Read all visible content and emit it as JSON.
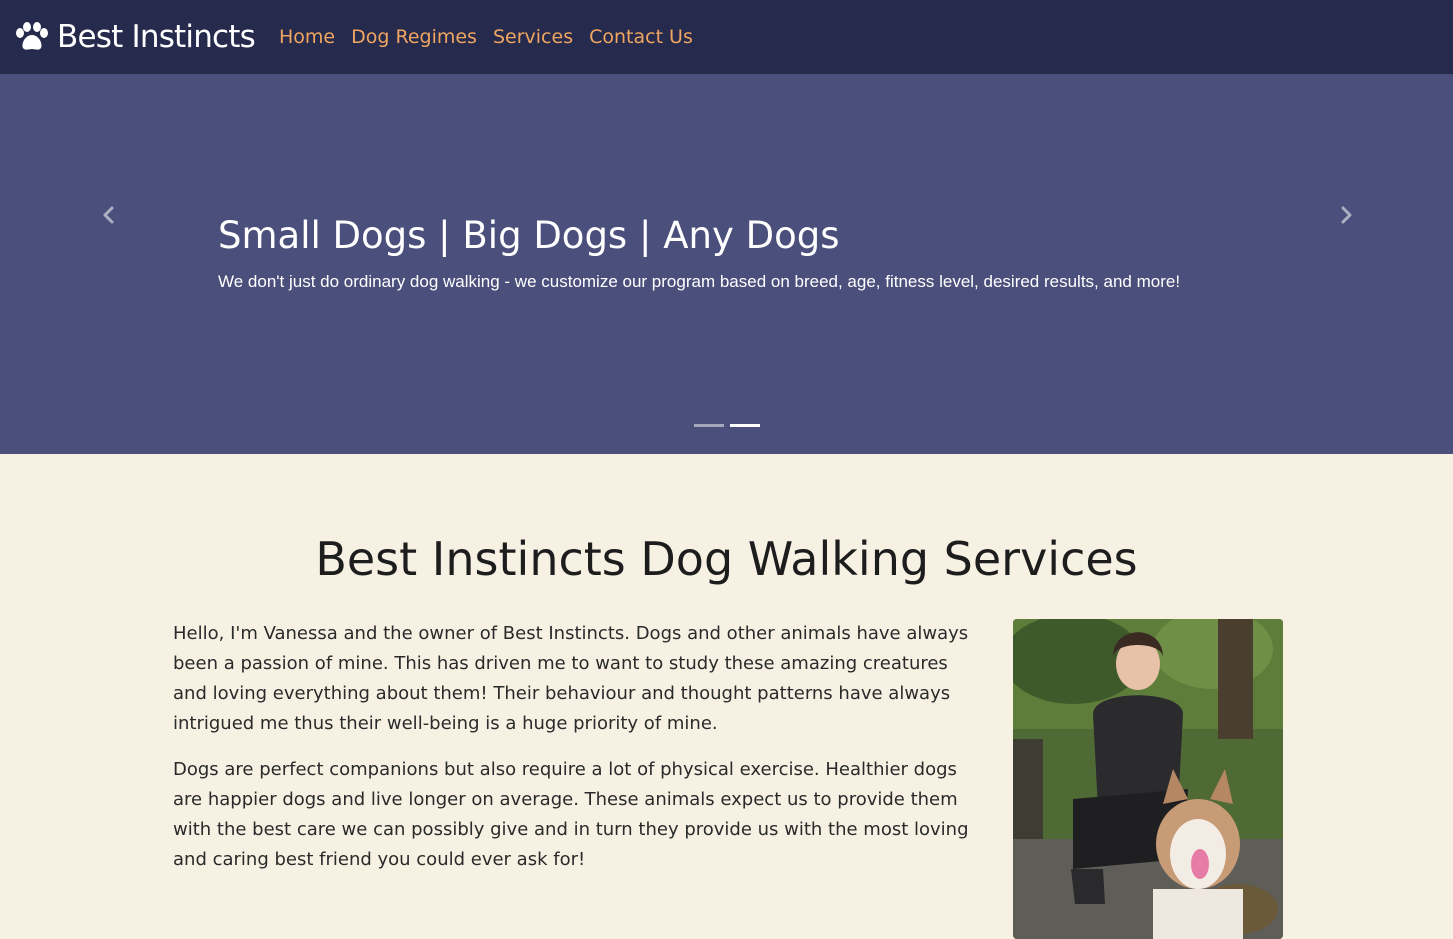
{
  "navbar": {
    "brand": "Best Instincts",
    "brand_icon": "paw-icon",
    "links": [
      "Home",
      "Dog Regimes",
      "Services",
      "Contact Us"
    ],
    "bg_color": "#262a4d",
    "link_color": "#f0a660"
  },
  "hero": {
    "title": "Small Dogs | Big Dogs | Any Dogs",
    "text": "We don't just do ordinary dog walking - we customize our program based on breed, age, fitness level, desired results, and more!",
    "bg_color": "#4b4f7b",
    "slide_count": 2,
    "active_slide": 2
  },
  "main": {
    "title": "Best Instincts Dog Walking Services",
    "paragraphs": [
      "Hello, I'm Vanessa and the owner of Best Instincts. Dogs and other animals have always been a passion of mine. This has driven me to want to study these amazing creatures and loving everything about them! Their behaviour and thought patterns have always intrigued me thus their well-being is a huge priority of mine.",
      "Dogs are perfect companions but also require a lot of physical exercise. Healthier dogs are happier dogs and live longer on average. These animals expect us to provide them with the best care we can possibly give and in turn they provide us with the most loving and caring best friend you could ever ask for!"
    ],
    "bg_color": "#f7f1e4"
  }
}
